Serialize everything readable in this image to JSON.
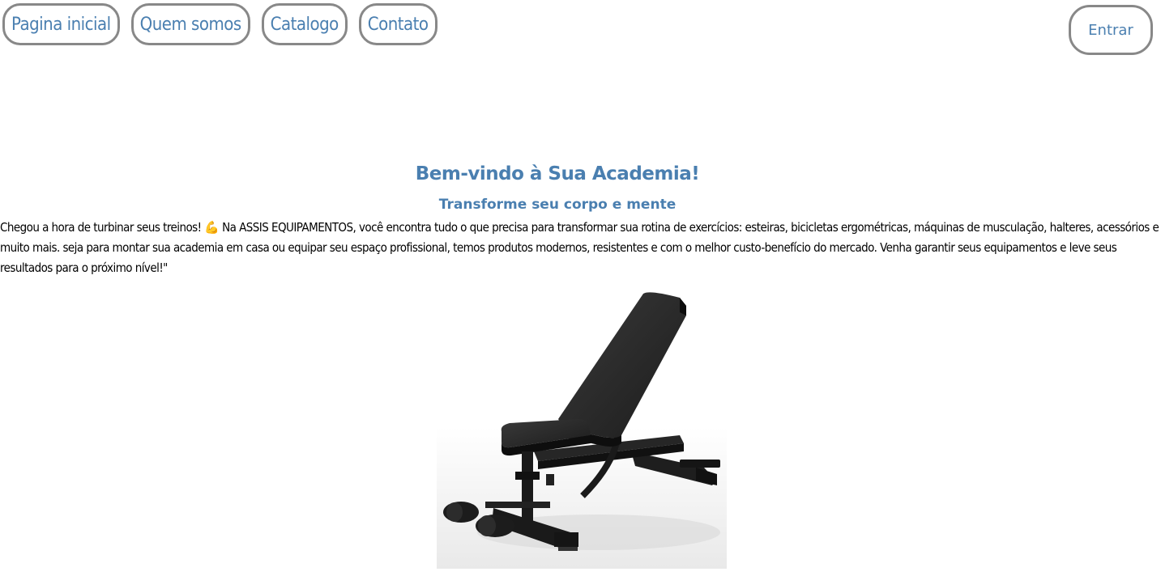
{
  "nav": {
    "items": [
      {
        "label": "Pagina inicial"
      },
      {
        "label": "Quem somos"
      },
      {
        "label": "Catalogo"
      },
      {
        "label": "Contato"
      }
    ],
    "login_label": "Entrar"
  },
  "hero": {
    "title": "Bem-vindo à Sua Academia!",
    "subtitle": "Transforme seu corpo e mente",
    "intro": "Chegou a hora de turbinar seus treinos! 💪 Na ASSIS EQUIPAMENTOS, você encontra tudo o que precisa para transformar sua rotina de exercícios: esteiras, bicicletas ergométricas, máquinas de musculação, halteres, acessórios e muito mais. seja para montar sua academia em casa ou equipar seu espaço profissional, temos produtos modernos, resistentes e com o melhor custo-benefício do mercado. Venha garantir seus equipamentos e leve seus resultados para o próximo nível!\""
  },
  "colors": {
    "accent": "#4a7fb0",
    "border": "#888888",
    "text": "#000000"
  },
  "product_image": {
    "icon": "weight-bench-image"
  }
}
